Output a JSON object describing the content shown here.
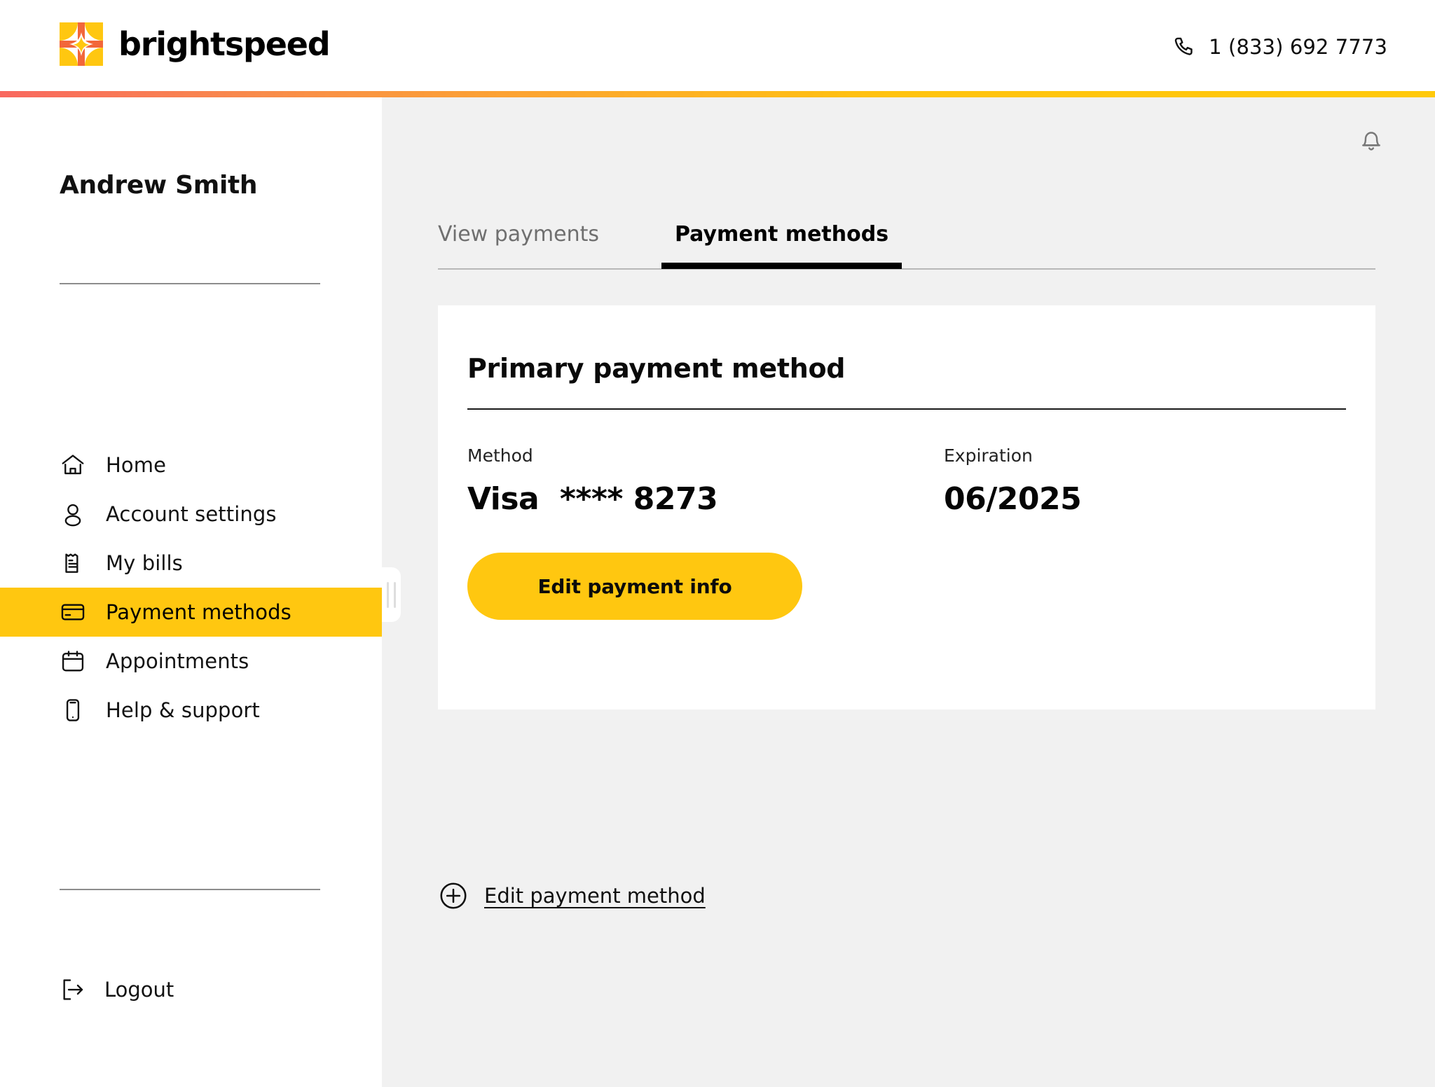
{
  "header": {
    "brand_name": "brightspeed",
    "logo_icon": "brightspeed-logo-icon",
    "phone_icon": "phone-icon",
    "phone_number": "1 (833) 692 7773",
    "accent_gradient_start": "#F9675E",
    "accent_gradient_end": "#FFC90A"
  },
  "sidebar": {
    "user_name": "Andrew Smith",
    "items": [
      {
        "label": "Home",
        "icon": "home-icon",
        "active": false
      },
      {
        "label": "Account settings",
        "icon": "user-icon",
        "active": false
      },
      {
        "label": "My bills",
        "icon": "receipt-icon",
        "active": false
      },
      {
        "label": "Payment methods",
        "icon": "credit-card-icon",
        "active": true
      },
      {
        "label": "Appointments",
        "icon": "calendar-icon",
        "active": false
      },
      {
        "label": "Help & support",
        "icon": "mobile-phone-icon",
        "active": false
      }
    ],
    "logout": {
      "label": "Logout",
      "icon": "logout-arrow-icon"
    },
    "active_highlight_color": "#FFC710"
  },
  "main": {
    "notification_icon": "bell-icon",
    "tabs": [
      {
        "label": "View payments",
        "active": false
      },
      {
        "label": "Payment methods",
        "active": true
      }
    ],
    "card": {
      "title": "Primary payment method",
      "method_label": "Method",
      "method_value": "Visa  **** 8273",
      "expiration_label": "Expiration",
      "expiration_value": "06/2025",
      "edit_button_label": "Edit payment info",
      "button_color": "#FFC710"
    },
    "edit_link": {
      "label": "Edit payment method",
      "icon": "plus-circle-icon"
    },
    "background_color": "#F1F1F1"
  }
}
